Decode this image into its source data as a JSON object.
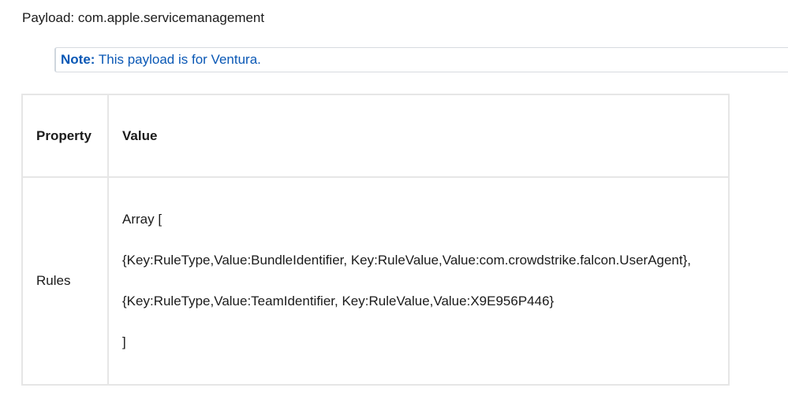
{
  "payload": {
    "text": "Payload: com.apple.servicemanagement"
  },
  "note": {
    "label": "Note:",
    "text": " This payload is for Ventura."
  },
  "table": {
    "headers": {
      "property": "Property",
      "value": "Value"
    },
    "rows": [
      {
        "property": "Rules",
        "value_lines": [
          "Array [",
          "{Key:RuleType,Value:BundleIdentifier, Key:RuleValue,Value:com.crowdstrike.falcon.UserAgent},",
          "{Key:RuleType,Value:TeamIdentifier, Key:RuleValue,Value:X9E956P446}",
          "]"
        ]
      }
    ]
  }
}
